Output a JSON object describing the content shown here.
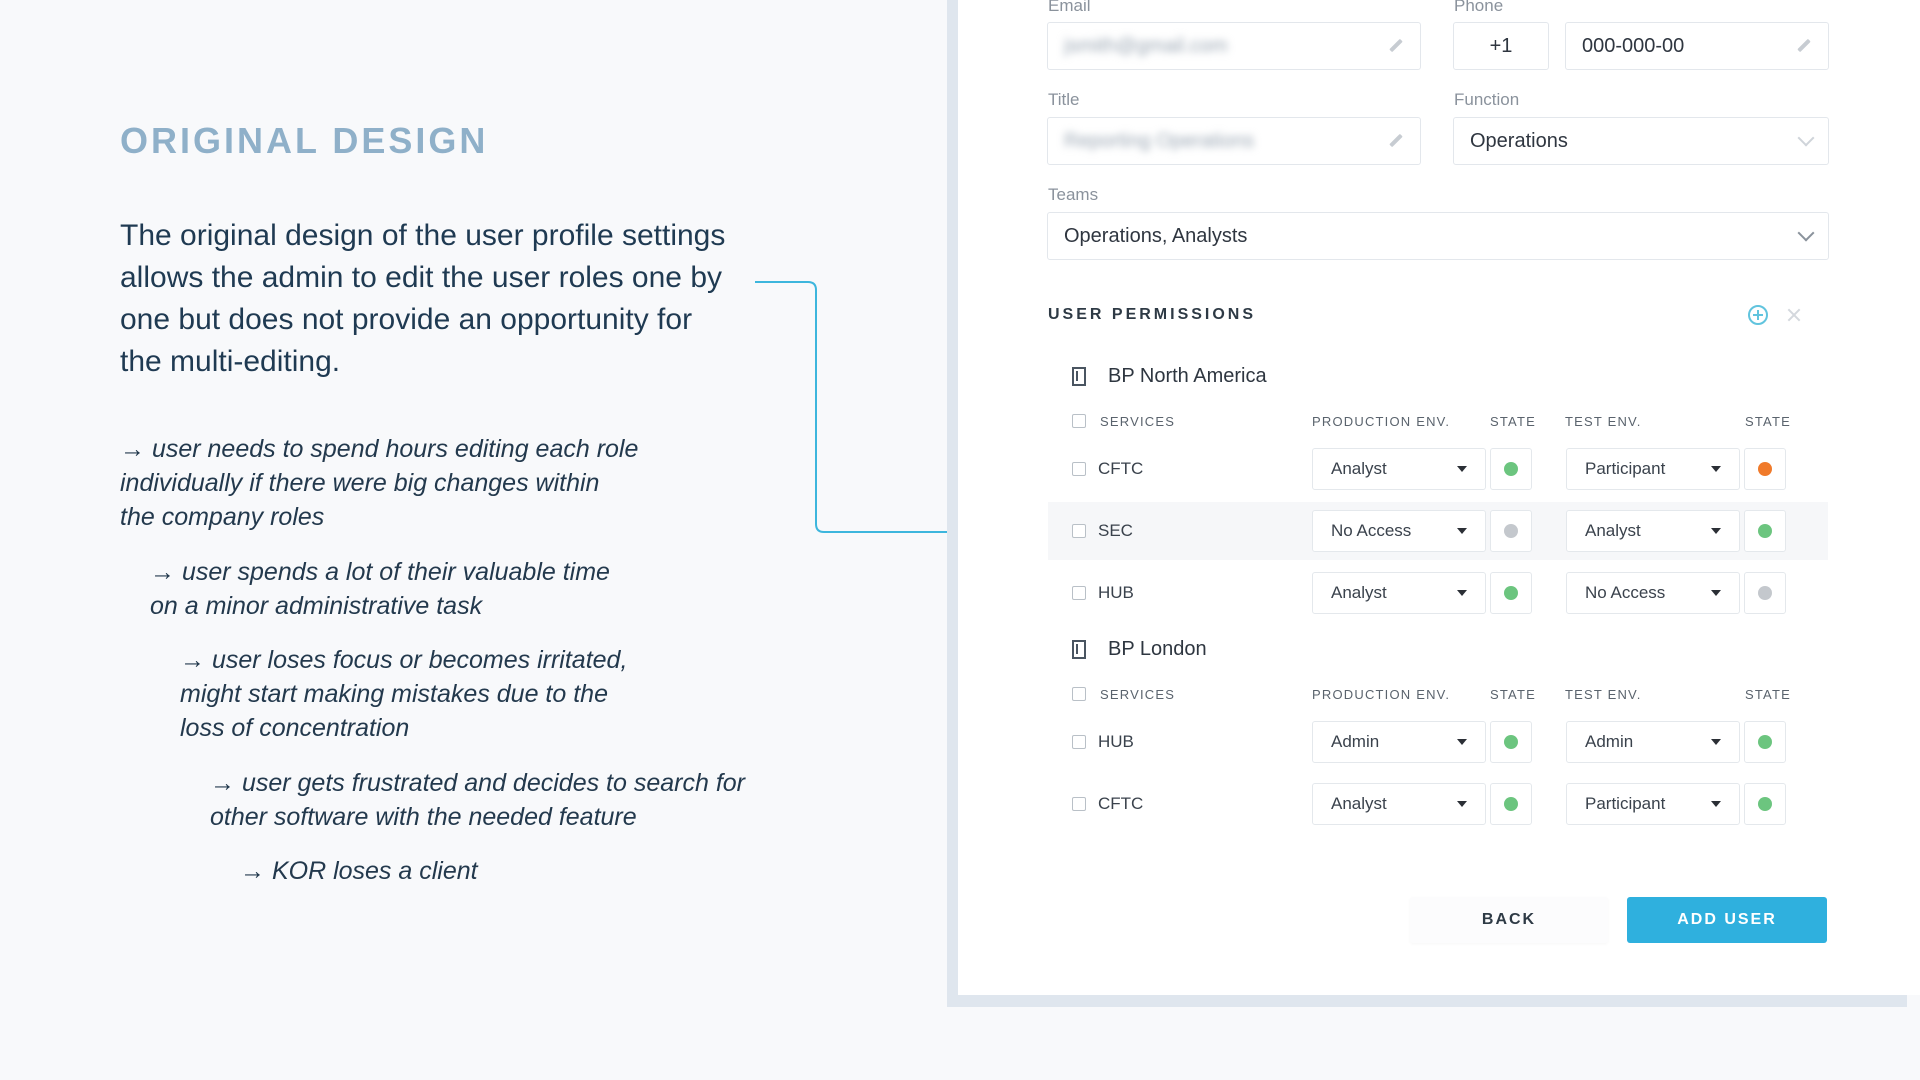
{
  "left": {
    "heading": "ORIGINAL DESIGN",
    "intro": "The original design of the user profile settings allows the admin to edit the user roles one by one but does not provide an opportunity for the multi-editing.",
    "bullets": [
      "→ user needs to spend hours editing each role individually if there were big changes within the company roles",
      "→ user spends a lot of their valuable time on a minor administrative task",
      "→ user loses focus or becomes irritated, might start making mistakes due to the loss of concentration",
      "→ user gets frustrated and decides to search for other software with the needed feature",
      "→ KOR loses a client"
    ]
  },
  "form": {
    "email_label": "Email",
    "email_value": "jsmith@gmail.com",
    "phone_label": "Phone",
    "phone_code": "+1",
    "phone_value": "000-000-00",
    "title_label": "Title",
    "title_value": "Reporting Operations",
    "function_label": "Function",
    "function_value": "Operations",
    "teams_label": "Teams",
    "teams_value": "Operations,  Analysts"
  },
  "permissions": {
    "title": "USER PERMISSIONS",
    "headers": {
      "services": "SERVICES",
      "production": "PRODUCTION ENV.",
      "state": "STATE",
      "test": "TEST ENV.",
      "state2": "STATE"
    },
    "groups": [
      {
        "name": "BP North America",
        "rows": [
          {
            "service": "CFTC",
            "prod": "Analyst",
            "prod_state": "#6cc57f",
            "test": "Participant",
            "test_state": "#f07a2a"
          },
          {
            "service": "SEC",
            "prod": "No Access",
            "prod_state": "#c4c8cd",
            "test": "Analyst",
            "test_state": "#6cc57f"
          },
          {
            "service": "HUB",
            "prod": "Analyst",
            "prod_state": "#6cc57f",
            "test": "No Access",
            "test_state": "#c4c8cd"
          }
        ]
      },
      {
        "name": "BP London",
        "rows": [
          {
            "service": "HUB",
            "prod": "Admin",
            "prod_state": "#6cc57f",
            "test": "Admin",
            "test_state": "#6cc57f"
          },
          {
            "service": "CFTC",
            "prod": "Analyst",
            "prod_state": "#6cc57f",
            "test": "Participant",
            "test_state": "#6cc57f"
          }
        ]
      }
    ]
  },
  "actions": {
    "back": "BACK",
    "add_user": "ADD USER"
  }
}
